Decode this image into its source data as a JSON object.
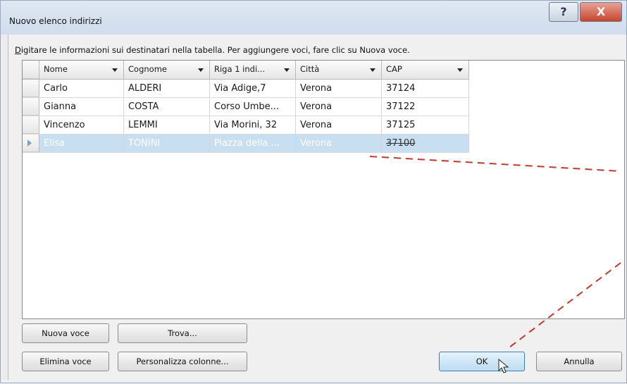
{
  "window": {
    "title": "Nuovo elenco indirizzi",
    "help_glyph": "?",
    "close_glyph": "X"
  },
  "instruction": {
    "first_letter": "D",
    "rest": "igitare le informazioni sui destinatari nella tabella. Per aggiungere voci, fare clic su Nuova voce."
  },
  "table": {
    "columns": [
      "Nome",
      "Cognome",
      "Riga 1 indi...",
      "Città",
      "CAP"
    ],
    "rows": [
      [
        "Carlo",
        "ALDERI",
        "Via Adige,7",
        "Verona",
        "37124"
      ],
      [
        "Gianna",
        "COSTA",
        "Corso Umbe...",
        "Verona",
        "37122"
      ],
      [
        "Vincenzo",
        "LEMMI",
        "Via Morini, 32",
        "Verona",
        "37125"
      ],
      [
        "Elisa",
        "TONINI",
        "Piazza della ...",
        "Verona",
        "37100"
      ]
    ],
    "selected_row_index": 3
  },
  "buttons": {
    "nuova_voce": "Nuova voce",
    "trova": "Trova...",
    "elimina_voce": "Elimina voce",
    "personalizza_colonne": "Personalizza colonne...",
    "ok": "OK",
    "annulla": "Annulla"
  },
  "colors": {
    "selection": "#c8dff1",
    "annotation_dash": "#c0392b",
    "ok_border": "#3c7fb1"
  }
}
